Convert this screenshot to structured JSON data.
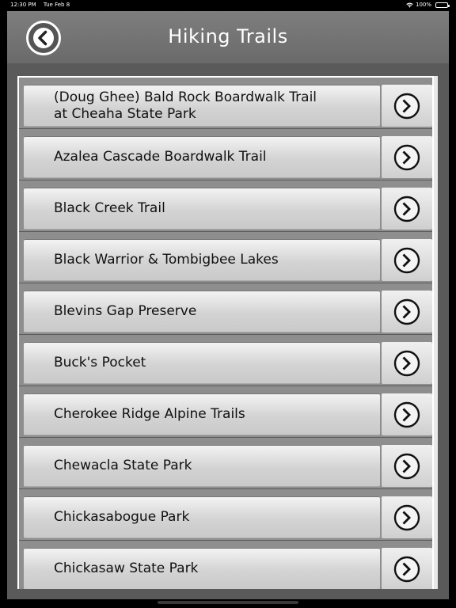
{
  "status_bar": {
    "time": "12:30 PM",
    "date": "Tue Feb 8",
    "battery": "100%"
  },
  "header": {
    "title": "Hiking Trails",
    "back_icon": "back-arrow-circle-icon"
  },
  "trails": [
    {
      "line1": "(Doug Ghee) Bald Rock Boardwalk Trail",
      "line2": "at Cheaha State Park"
    },
    {
      "line1": "Azalea Cascade Boardwalk Trail",
      "line2": ""
    },
    {
      "line1": "Black Creek Trail",
      "line2": ""
    },
    {
      "line1": "Black Warrior & Tombigbee Lakes",
      "line2": ""
    },
    {
      "line1": "Blevins Gap Preserve",
      "line2": ""
    },
    {
      "line1": "Buck's Pocket",
      "line2": ""
    },
    {
      "line1": "Cherokee Ridge Alpine Trails",
      "line2": ""
    },
    {
      "line1": "Chewacla State Park",
      "line2": ""
    },
    {
      "line1": "Chickasabogue Park",
      "line2": ""
    },
    {
      "line1": "Chickasaw State Park",
      "line2": ""
    }
  ]
}
